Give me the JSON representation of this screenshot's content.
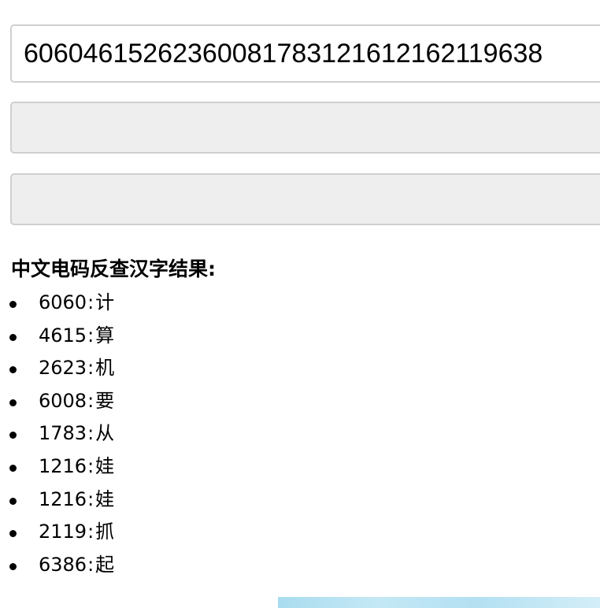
{
  "inputs": {
    "code_value": "60604615262360081783121612162119638",
    "second_value": "",
    "third_value": ""
  },
  "results": {
    "heading": "中文电码反查汉字结果:",
    "separator": ":",
    "items": [
      {
        "code": "6060",
        "char": "计"
      },
      {
        "code": "4615",
        "char": "算"
      },
      {
        "code": "2623",
        "char": "机"
      },
      {
        "code": "6008",
        "char": "要"
      },
      {
        "code": "1783",
        "char": "从"
      },
      {
        "code": "1216",
        "char": "娃"
      },
      {
        "code": "1216",
        "char": "娃"
      },
      {
        "code": "2119",
        "char": "抓"
      },
      {
        "code": "6386",
        "char": "起"
      }
    ]
  },
  "colors": {
    "field_border": "#cfcfcf",
    "field_disabled_bg": "#eeeeee",
    "banner_blue": "#b3e0f2"
  }
}
